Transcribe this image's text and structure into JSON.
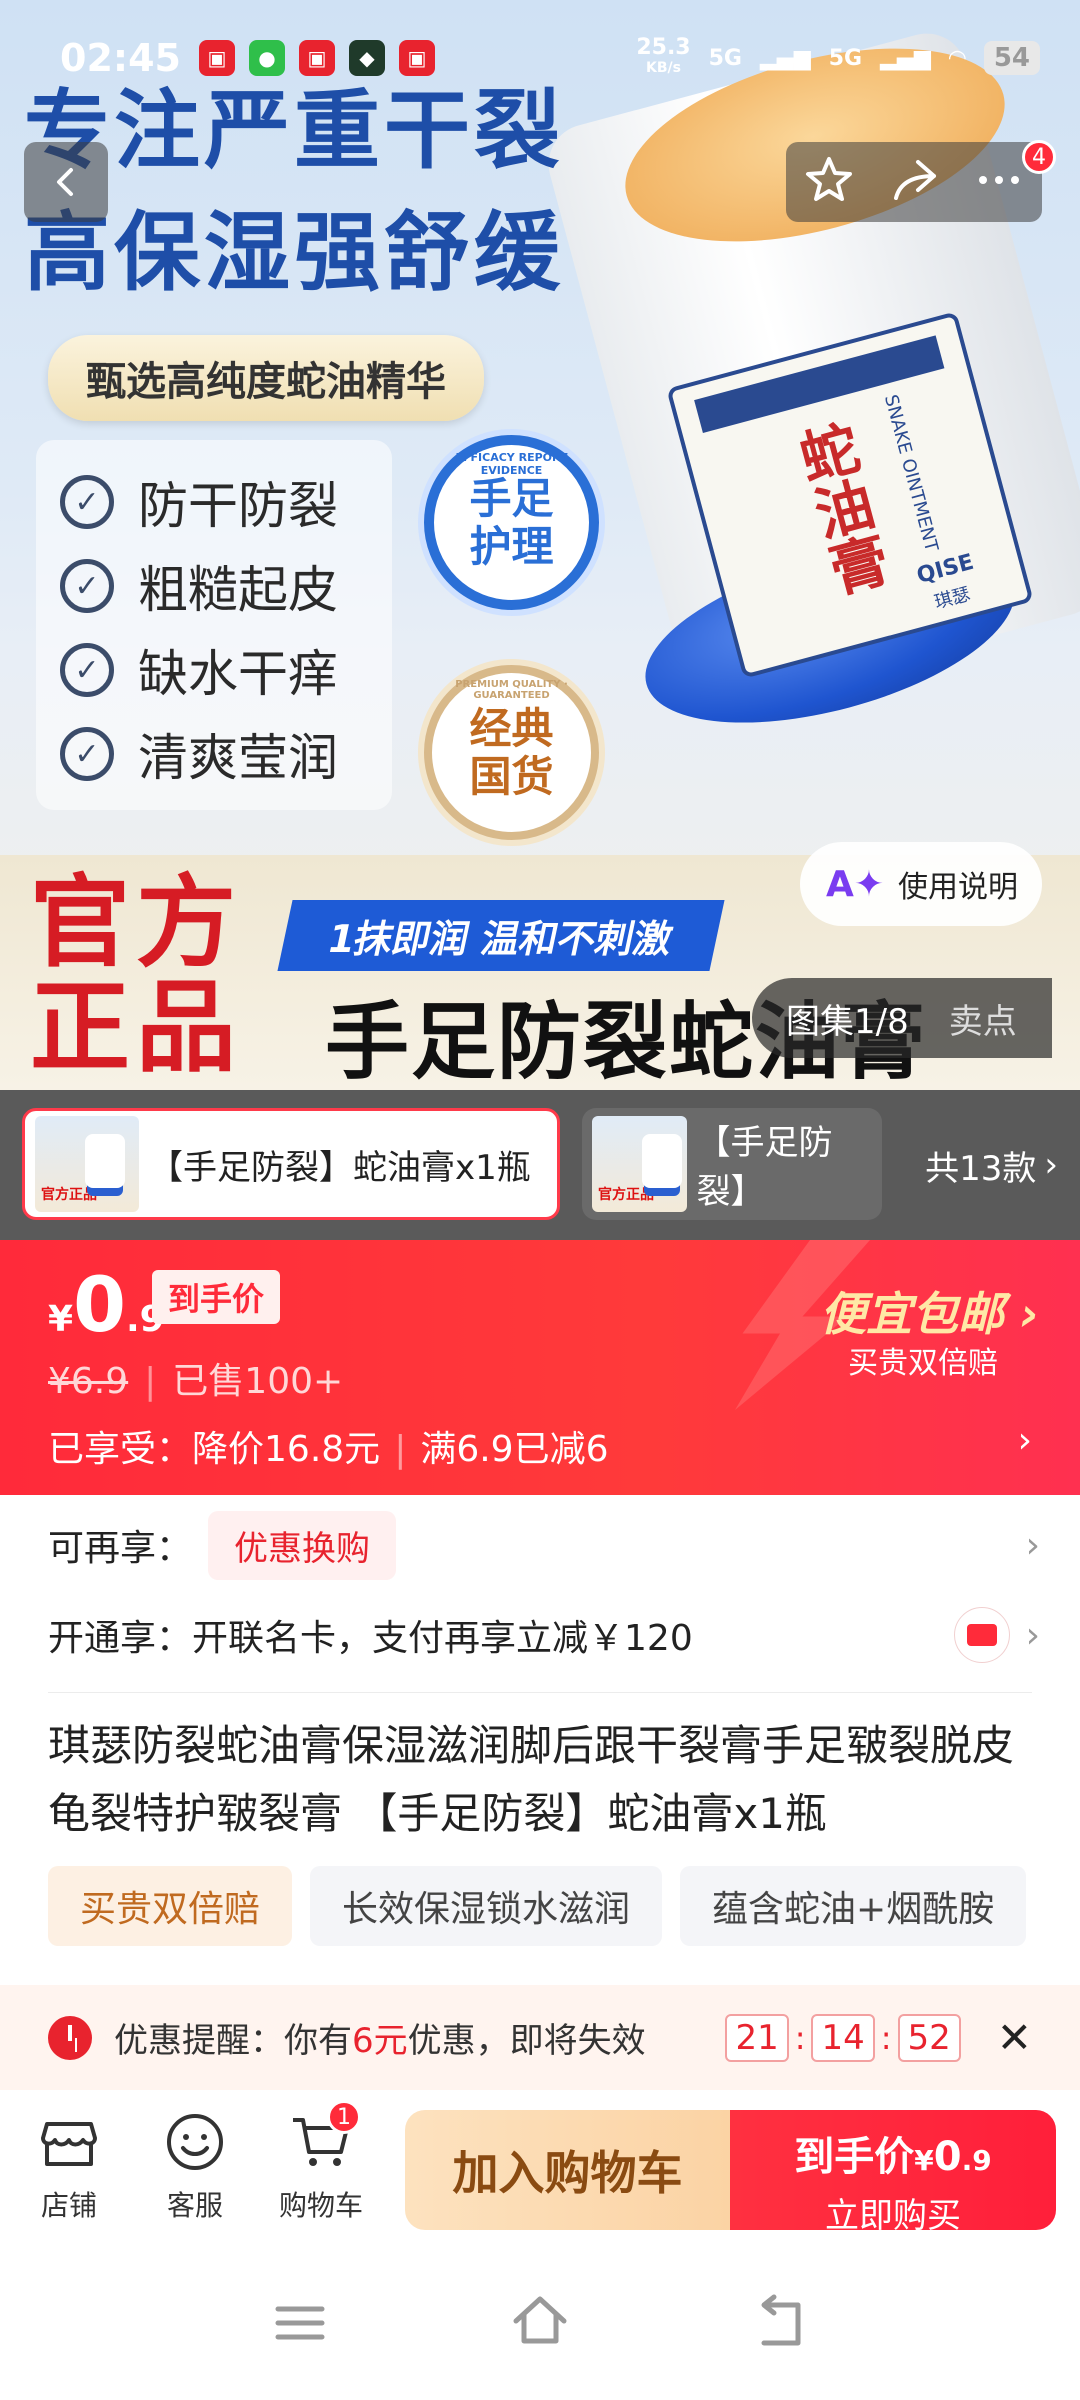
{
  "status_bar": {
    "time": "02:45",
    "net_speed": "25.3",
    "net_unit": "KB/s",
    "signal1": "5G",
    "signal2": "5G",
    "battery": "54"
  },
  "header": {
    "notification_count": "4"
  },
  "hero": {
    "headline_line1": "专注严重干裂",
    "headline_line2": "高保湿强舒缓",
    "pill": "甄选高纯度蛇油精华",
    "features": [
      "防干防裂",
      "粗糙起皮",
      "缺水干痒",
      "清爽莹润"
    ],
    "seal1": "手足\n护理",
    "seal1_ring": "EFFICACY REPORT EVIDENCE",
    "seal2": "经典\n国货",
    "seal2_ring": "PREMIUM QUALITY · GUARANTEED",
    "label_cn": "蛇油膏",
    "label_en": "SNAKE OINTMENT",
    "label_brand": "QISE",
    "label_brand_cn": "琪瑟",
    "official_1": "官方",
    "official_2": "正品",
    "blue_tag": "1抹即润 温和不刺激",
    "product_name": "手足防裂蛇油膏110g",
    "usage_button": "使用说明",
    "gallery_counter": "图集1/8",
    "gallery_tab2": "卖点"
  },
  "variants": {
    "items": [
      {
        "label": "【手足防裂】蛇油膏x1瓶",
        "thumb_text": "官方正品"
      },
      {
        "label": "【手足防裂】",
        "thumb_text": "官方正品"
      }
    ],
    "more_label": "共13款"
  },
  "price": {
    "currency": "¥",
    "int": "0",
    "dec": ".9",
    "final_tag": "到手价",
    "original": "¥6.9",
    "sold": "已售100+",
    "enjoyed_prefix": "已享受：",
    "discount1": "降价16.8元",
    "discount2": "满6.9已减6",
    "shipping_title": "便宜包邮",
    "shipping_sub": "买贵双倍赔"
  },
  "info": {
    "promo_label": "可再享：",
    "promo_tag": "优惠换购",
    "card_label": "开通享：",
    "card_text": "开联名卡，支付再享立减￥120",
    "title": "琪瑟防裂蛇油膏保湿滋润脚后跟干裂膏手足皲裂脱皮龟裂特护皲裂膏 【手足防裂】蛇油膏x1瓶",
    "tags": [
      "买贵双倍赔",
      "长效保湿锁水滋润",
      "蕴含蛇油+烟酰胺"
    ]
  },
  "reminder": {
    "prefix": "优惠提醒：你有",
    "amount": "6元",
    "suffix": "优惠，即将失效",
    "timer": [
      "21",
      "14",
      "52"
    ]
  },
  "bottom_bar": {
    "shop": "店铺",
    "service": "客服",
    "cart": "购物车",
    "cart_count": "1",
    "add_to_cart": "加入购物车",
    "buy_price_label": "到手价",
    "buy_currency": "¥",
    "buy_price_int": "0",
    "buy_price_dec": ".9",
    "buy_now": "立即购买"
  },
  "colors": {
    "accent_red": "#ff2b3a",
    "hero_blue": "#1e4ea8",
    "cart_button": "#fbd3a4",
    "lid_blue": "#1f55d0"
  }
}
